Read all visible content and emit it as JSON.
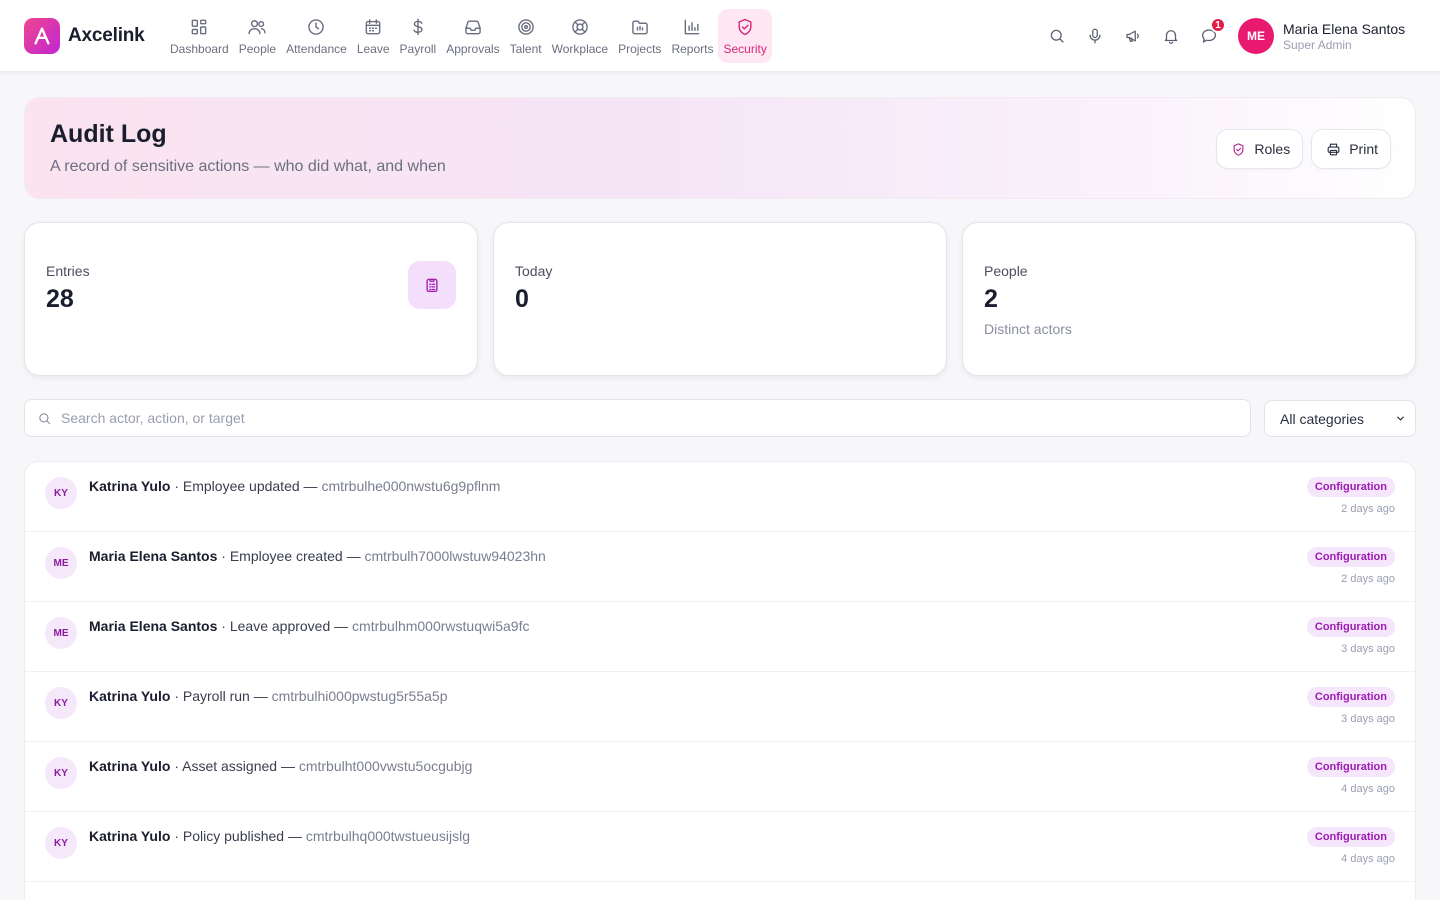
{
  "brand": {
    "name": "Axcelink"
  },
  "nav": [
    {
      "label": "Dashboard",
      "icon": "grid-icon"
    },
    {
      "label": "People",
      "icon": "users-icon"
    },
    {
      "label": "Attendance",
      "icon": "clock-icon"
    },
    {
      "label": "Leave",
      "icon": "calendar-icon"
    },
    {
      "label": "Payroll",
      "icon": "dollar-icon"
    },
    {
      "label": "Approvals",
      "icon": "inbox-icon"
    },
    {
      "label": "Talent",
      "icon": "target-icon"
    },
    {
      "label": "Workplace",
      "icon": "lifebuoy-icon"
    },
    {
      "label": "Projects",
      "icon": "folder-icon"
    },
    {
      "label": "Reports",
      "icon": "bar-chart-icon"
    },
    {
      "label": "Security",
      "icon": "shield-check-icon",
      "active": true
    }
  ],
  "header_actions": {
    "notifications_badge": "1"
  },
  "user": {
    "initials": "ME",
    "name": "Maria Elena Santos",
    "role": "Super Admin"
  },
  "page": {
    "title": "Audit Log",
    "subtitle": "A record of sensitive actions — who did what, and when",
    "roles_label": "Roles",
    "print_label": "Print"
  },
  "stats": {
    "entries": {
      "label": "Entries",
      "value": "28"
    },
    "today": {
      "label": "Today",
      "value": "0"
    },
    "people": {
      "label": "People",
      "value": "2",
      "hint": "Distinct actors"
    }
  },
  "filters": {
    "search_placeholder": "Search actor, action, or target",
    "category": "All categories"
  },
  "entries": [
    {
      "initials": "KY",
      "actor": "Katrina Yulo",
      "action": "Employee updated",
      "target": "cmtrbulhe000nwstu6g9pflnm",
      "category": "Configuration",
      "when": "2 days ago"
    },
    {
      "initials": "ME",
      "actor": "Maria Elena Santos",
      "action": "Employee created",
      "target": "cmtrbulh7000lwstuw94023hn",
      "category": "Configuration",
      "when": "2 days ago"
    },
    {
      "initials": "ME",
      "actor": "Maria Elena Santos",
      "action": "Leave approved",
      "target": "cmtrbulhm000rwstuqwi5a9fc",
      "category": "Configuration",
      "when": "3 days ago"
    },
    {
      "initials": "KY",
      "actor": "Katrina Yulo",
      "action": "Payroll run",
      "target": "cmtrbulhi000pwstug5r55a5p",
      "category": "Configuration",
      "when": "3 days ago"
    },
    {
      "initials": "KY",
      "actor": "Katrina Yulo",
      "action": "Asset assigned",
      "target": "cmtrbulht000vwstu5ocgubjg",
      "category": "Configuration",
      "when": "4 days ago"
    },
    {
      "initials": "KY",
      "actor": "Katrina Yulo",
      "action": "Policy published",
      "target": "cmtrbulhq000twstueusijslg",
      "category": "Configuration",
      "when": "4 days ago"
    }
  ]
}
